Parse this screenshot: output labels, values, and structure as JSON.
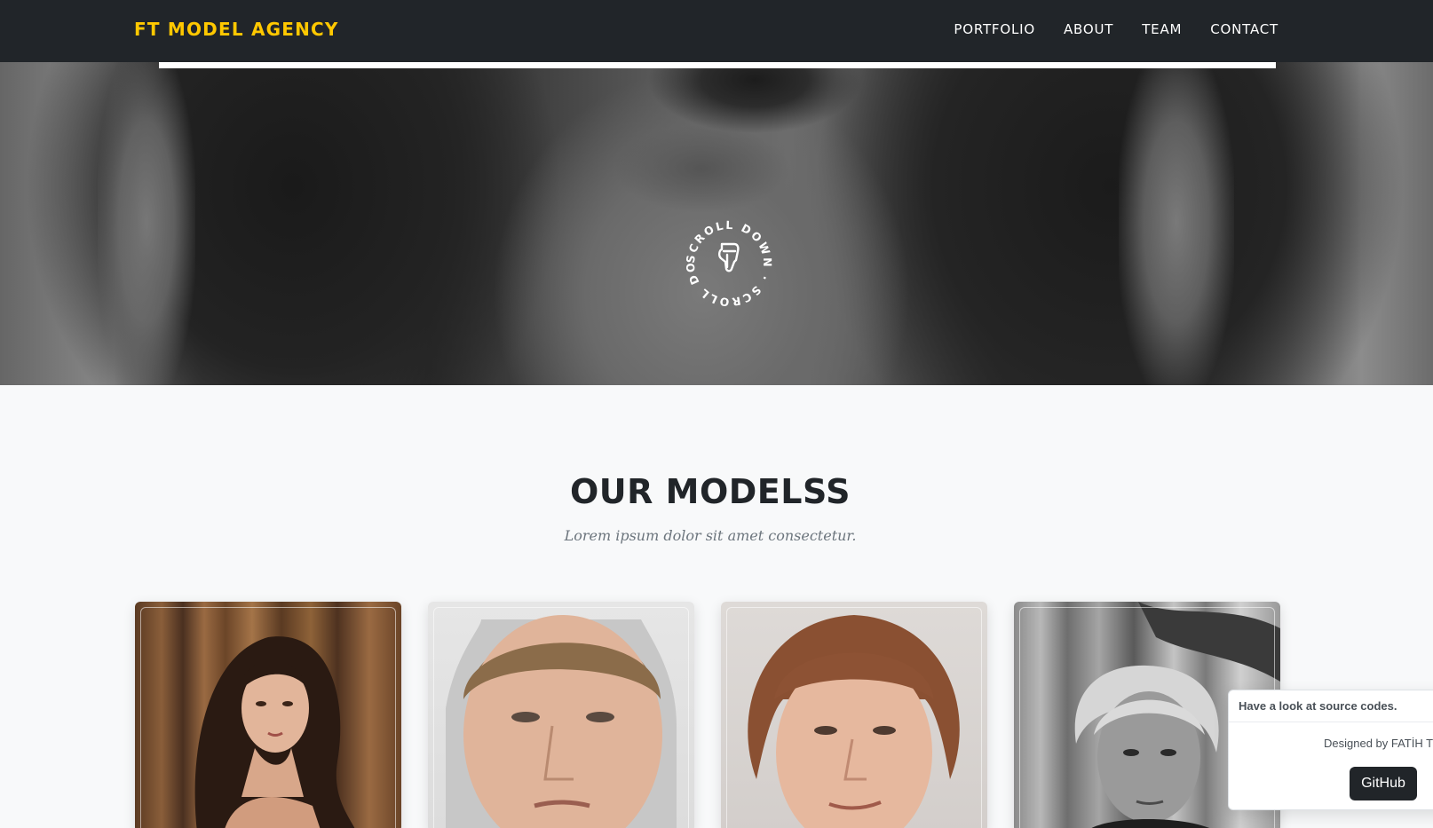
{
  "navbar": {
    "brand": "FT MODEL AGENCY",
    "links": [
      "PORTFOLIO",
      "ABOUT",
      "TEAM",
      "CONTACT"
    ]
  },
  "hero": {
    "scroll_text": "SCROLL DOWN · SCROLL DOWN ·",
    "icon": "pointing-hand-icon"
  },
  "models_section": {
    "title": "OUR MODELSS",
    "subtitle": "Lorem ipsum dolor sit amet consectetur."
  },
  "toast": {
    "header": "Have a look at source codes.",
    "credit": "Designed by FATİH T",
    "button": "GitHub"
  },
  "colors": {
    "navbar_bg": "#212529",
    "brand": "#ffc800",
    "page_bg": "#f8f9fa",
    "button_bg": "#212529"
  }
}
